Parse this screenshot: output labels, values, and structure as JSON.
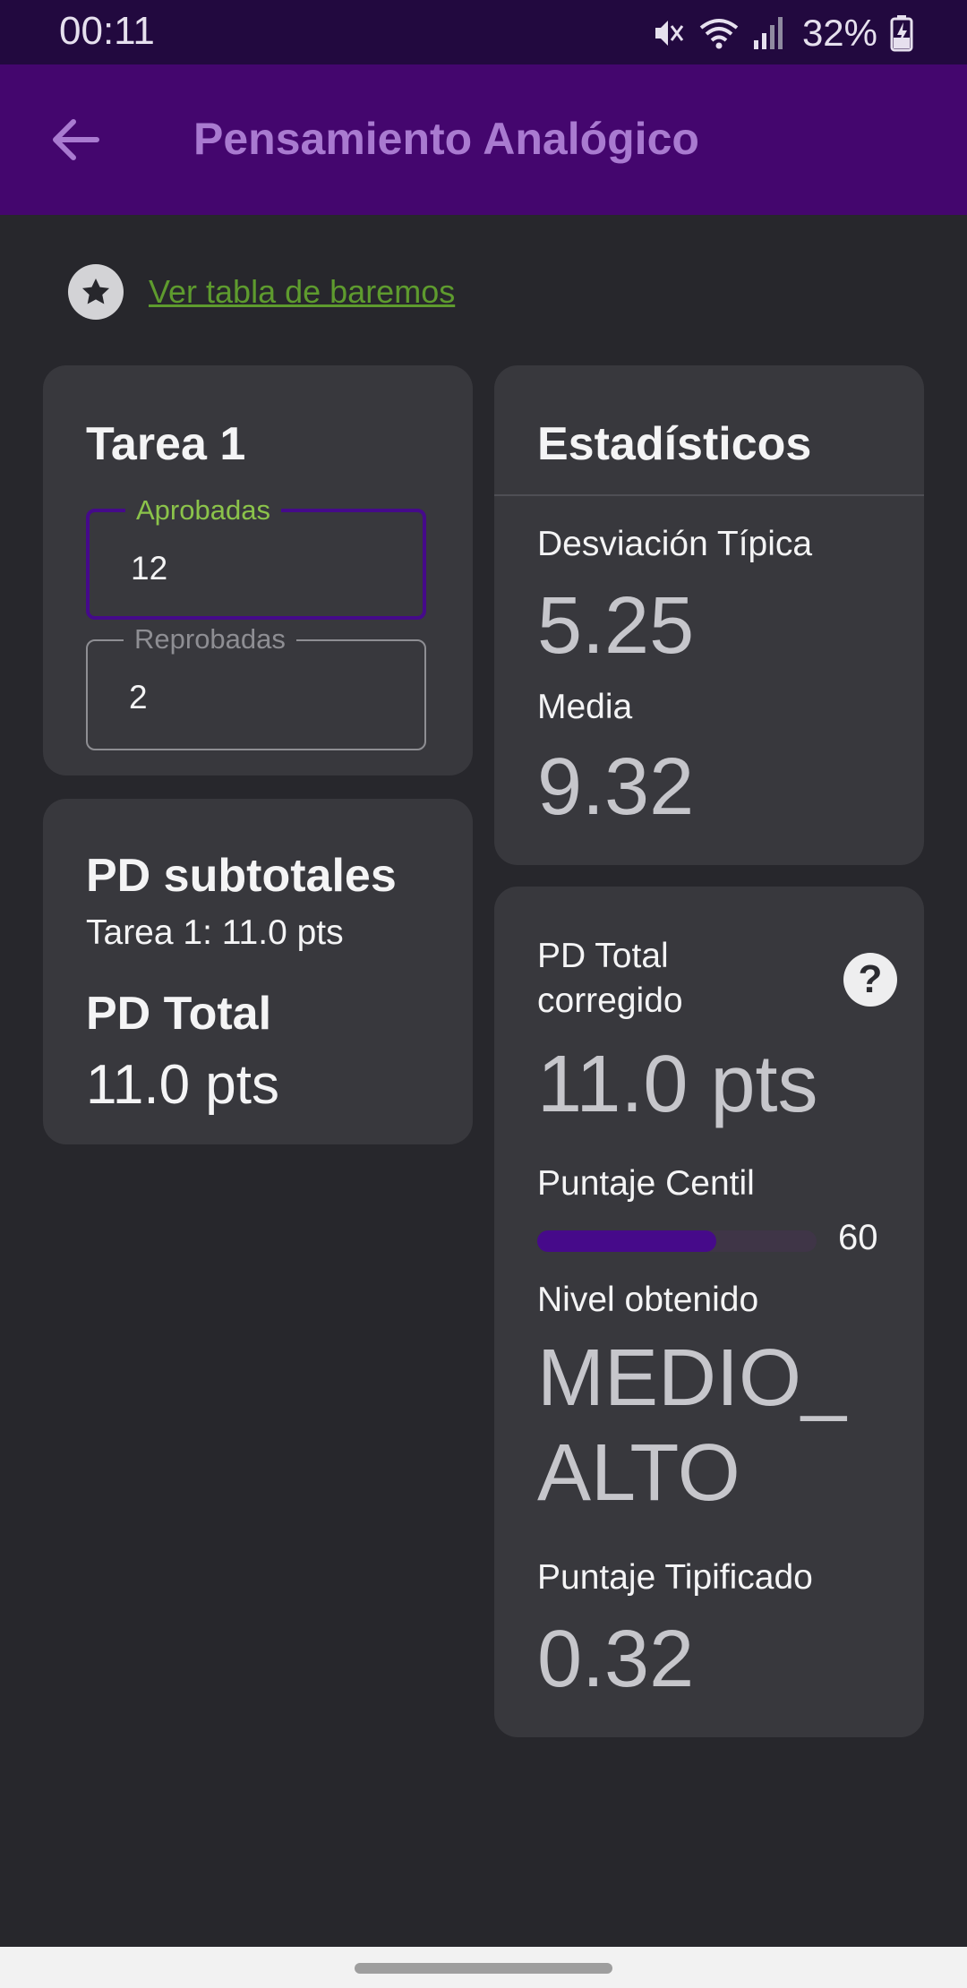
{
  "status_bar": {
    "time": "00:11",
    "battery": "32%",
    "icons": [
      "mute-icon",
      "wifi-icon",
      "signal-icon",
      "battery-charging-icon"
    ]
  },
  "app_bar": {
    "title": "Pensamiento Analógico",
    "back_icon": "arrow-back-icon"
  },
  "baremos": {
    "icon": "star-icon",
    "link": "Ver tabla de baremos"
  },
  "tarea_card": {
    "title": "Tarea 1",
    "aprobadas": {
      "label": "Aprobadas",
      "value": "12"
    },
    "reprobadas": {
      "label": "Reprobadas",
      "value": "2"
    }
  },
  "pd_card": {
    "subtotales_title": "PD subtotales",
    "subtotal_line": "Tarea 1: 11.0 pts",
    "total_title": "PD Total",
    "total_value": "11.0 pts"
  },
  "stats_card": {
    "title": "Estadísticos",
    "desviacion_label": "Desviación Típica",
    "desviacion_value": "5.25",
    "media_label": "Media",
    "media_value": "9.32"
  },
  "result_card": {
    "pd_corregido_label_1": "PD Total",
    "pd_corregido_label_2": "corregido",
    "pd_corregido_value": "11.0 pts",
    "help_symbol": "?",
    "centil_label": "Puntaje Centil",
    "centil_value": "60",
    "centil_progress_percent": 64,
    "nivel_label": "Nivel obtenido",
    "nivel_line_1": "MEDIO_",
    "nivel_line_2": "ALTO",
    "tipificado_label": "Puntaje Tipificado",
    "tipificado_value": "0.32"
  },
  "colors": {
    "status_bar": "#22093f",
    "app_bar": "#44066e",
    "title": "#a97ad0",
    "background": "#27272c",
    "card": "#38383d",
    "link": "#5e9b2e",
    "focused_label": "#8bc34a",
    "accent": "#450a8a"
  }
}
